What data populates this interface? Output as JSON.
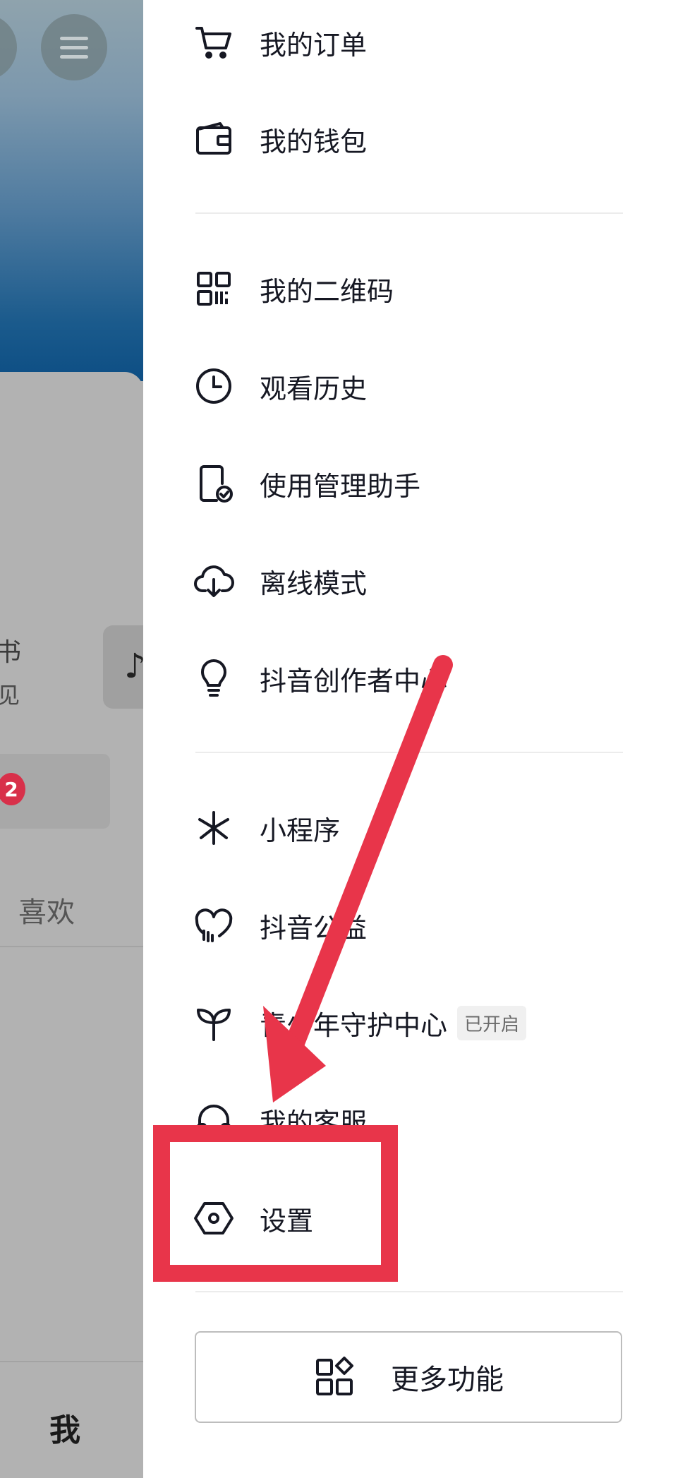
{
  "background_page": {
    "partial_text_book": "书",
    "partial_text_see": "见",
    "music_icon": "music-note-icon",
    "message_badge_count": "2",
    "tab_like": "喜欢",
    "bottom_tab_me": "我"
  },
  "drawer": {
    "items": [
      {
        "label": "我的订单",
        "icon": "cart-icon"
      },
      {
        "label": "我的钱包",
        "icon": "wallet-icon"
      },
      {
        "label": "我的二维码",
        "icon": "qr-code-icon"
      },
      {
        "label": "观看历史",
        "icon": "clock-icon"
      },
      {
        "label": "使用管理助手",
        "icon": "phone-check-icon"
      },
      {
        "label": "离线模式",
        "icon": "cloud-download-icon"
      },
      {
        "label": "抖音创作者中心",
        "icon": "lightbulb-icon"
      },
      {
        "label": "小程序",
        "icon": "mini-program-icon"
      },
      {
        "label": "抖音公益",
        "icon": "heart-icon"
      },
      {
        "label": "青少年守护中心",
        "icon": "sprout-icon",
        "tag": "已开启"
      },
      {
        "label": "我的客服",
        "icon": "headset-icon"
      },
      {
        "label": "设置",
        "icon": "settings-hexagon-icon"
      }
    ],
    "more_button": {
      "label": "更多功能",
      "icon": "grid-apps-icon"
    }
  },
  "annotation": {
    "arrow_color": "#e8354a",
    "highlight_color": "#e8354a",
    "highlight_target": "设置"
  }
}
